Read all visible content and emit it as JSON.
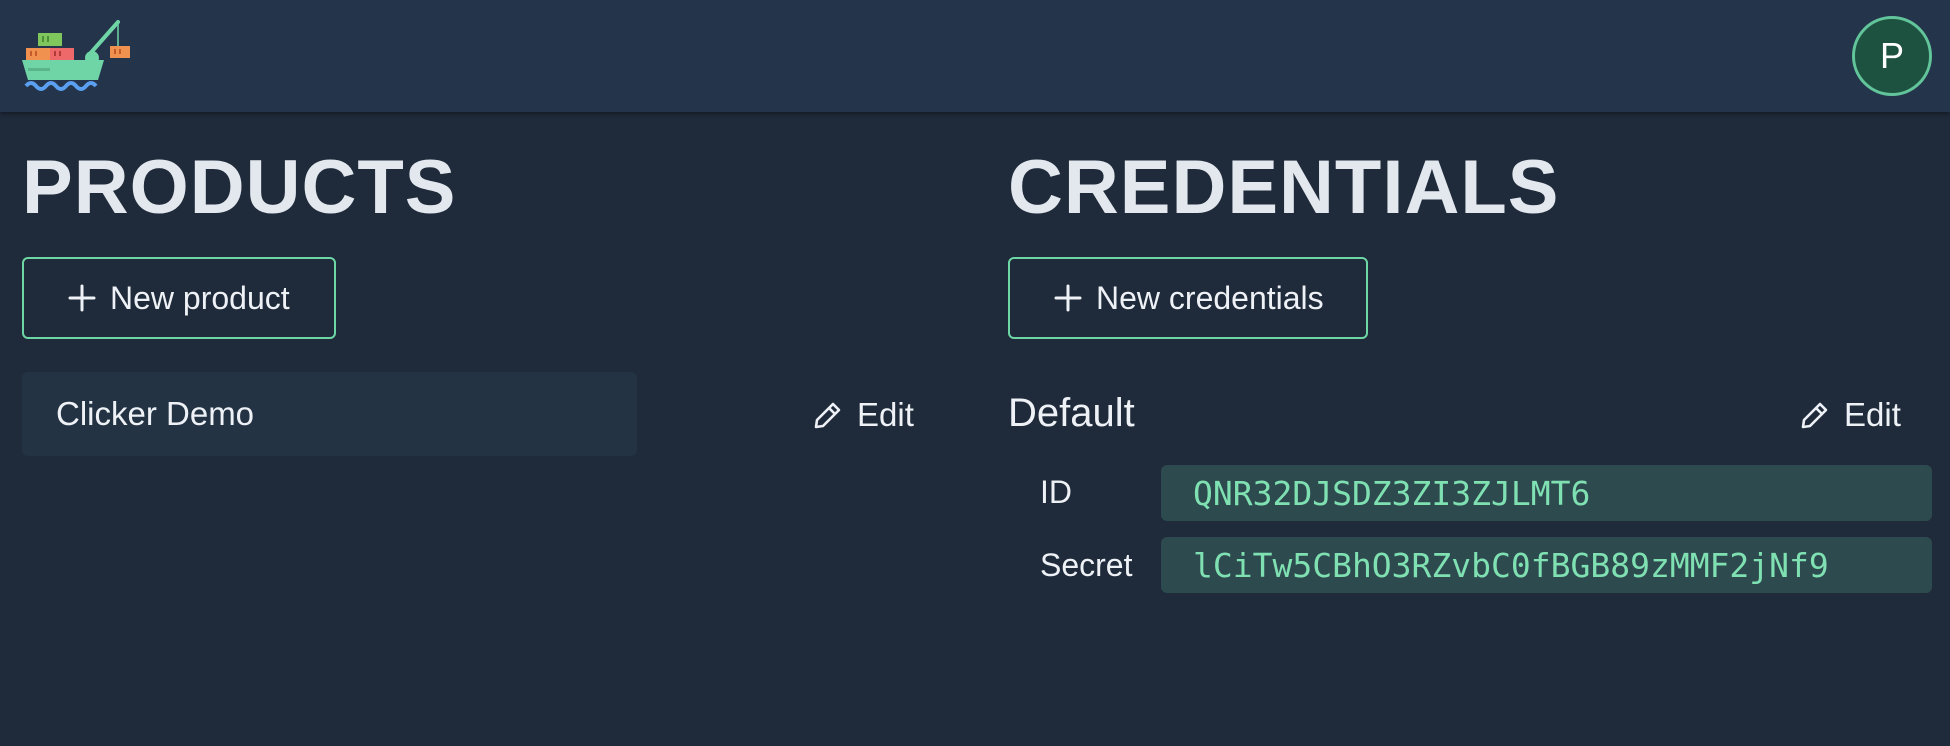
{
  "header": {
    "logo_icon": "cargo-ship-icon",
    "avatar_initial": "P"
  },
  "products": {
    "title": "PRODUCTS",
    "new_button_label": "New product",
    "items": [
      {
        "name": "Clicker Demo",
        "edit_label": "Edit"
      }
    ]
  },
  "credentials": {
    "title": "CREDENTIALS",
    "new_button_label": "New credentials",
    "items": [
      {
        "name": "Default",
        "edit_label": "Edit",
        "id_label": "ID",
        "id_value": "QNR32DJSDZ3ZI3ZJLMT6",
        "secret_label": "Secret",
        "secret_value": "lCiTw5CBhO3RZvbC0fBGB89zMMF2jNf9"
      }
    ]
  },
  "colors": {
    "background": "#1f2a3a",
    "topbar": "#24344a",
    "accent": "#6dd6a4",
    "mono_text": "#7fe0b2"
  }
}
